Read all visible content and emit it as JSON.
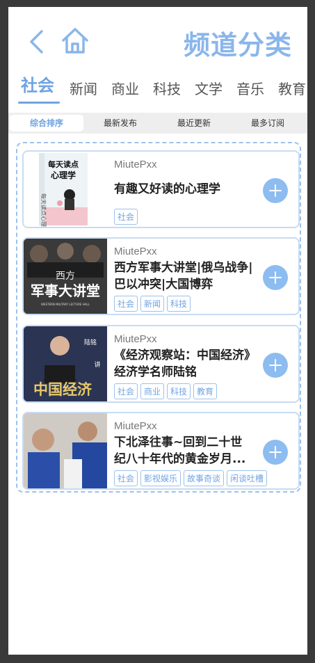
{
  "header": {
    "title": "频道分类",
    "back_icon": "chevron-left-icon",
    "home_icon": "home-icon",
    "accent_color": "#8ab6ea"
  },
  "tabs": [
    {
      "label": "社会",
      "active": true
    },
    {
      "label": "新闻"
    },
    {
      "label": "商业"
    },
    {
      "label": "科技"
    },
    {
      "label": "文学"
    },
    {
      "label": "音乐"
    },
    {
      "label": "教育"
    }
  ],
  "sort_options": [
    {
      "label": "综合排序",
      "active": true
    },
    {
      "label": "最新发布"
    },
    {
      "label": "最近更新"
    },
    {
      "label": "最多订阅"
    }
  ],
  "items": [
    {
      "author": "MiutePxx",
      "title": "有趣又好读的心理学",
      "tags": [
        "社会"
      ],
      "cover": {
        "line1": "每天读点",
        "line2": "心理学"
      }
    },
    {
      "author": "MiutePxx",
      "title": "西方军事大讲堂|俄乌战争|巴以冲突|大国博弈",
      "tags": [
        "社会",
        "新闻",
        "科技"
      ],
      "cover": {
        "line1": "西方",
        "line2": "军事大讲堂",
        "line3": "WESTERN MILITARY LECTURE HALL"
      }
    },
    {
      "author": "MiutePxx",
      "title": "《经济观察站：中国经济》经济学名师陆铭",
      "tags": [
        "社会",
        "商业",
        "科技",
        "教育"
      ],
      "cover": {
        "line1": "陆铭",
        "line2": "讲",
        "line3": "中国经济"
      }
    },
    {
      "author": "MiutePxx",
      "title": "下北泽往事~回到二十世纪八十年代的黄金岁月...",
      "tags": [
        "社会",
        "影视娱乐",
        "故事奇谈",
        "闲谈吐槽"
      ],
      "cover": {}
    }
  ]
}
